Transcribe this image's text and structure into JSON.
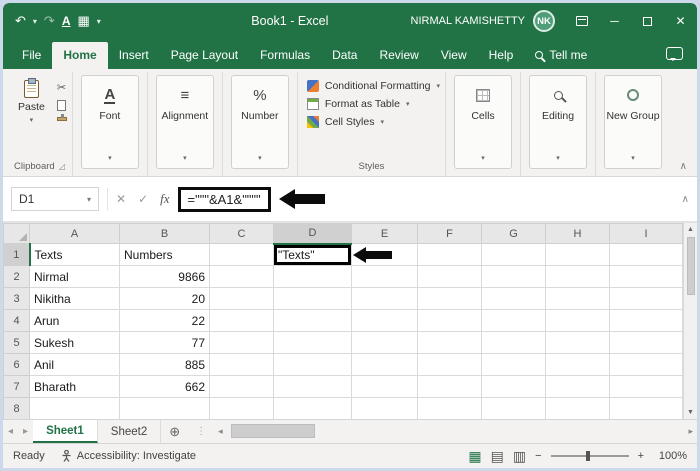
{
  "titlebar": {
    "title": "Book1 - Excel",
    "user": "NIRMAL KAMISHETTY",
    "avatar": "NK",
    "icons": {
      "undo": "↶",
      "redo": "↷",
      "underline": "A",
      "table": "▦",
      "caret": "▾"
    },
    "window": {
      "min": "─",
      "close": "✕"
    }
  },
  "tabs": [
    {
      "label": "File"
    },
    {
      "label": "Home",
      "active": true
    },
    {
      "label": "Insert"
    },
    {
      "label": "Page Layout"
    },
    {
      "label": "Formulas"
    },
    {
      "label": "Data"
    },
    {
      "label": "Review"
    },
    {
      "label": "View"
    },
    {
      "label": "Help"
    },
    {
      "label": "Tell me"
    }
  ],
  "ribbon": {
    "paste": "Paste",
    "caret": "▾",
    "collapse": "∧",
    "cut": "✂",
    "font_icon": "A",
    "alignment_icon": "≡",
    "number_icon": "%",
    "styles_items": [
      "Conditional Formatting",
      "Format as Table",
      "Cell Styles"
    ],
    "groups": {
      "clipboard": "Clipboard",
      "font": "Font",
      "alignment": "Alignment",
      "number": "Number",
      "styles": "Styles",
      "cells": "Cells",
      "editing": "Editing",
      "new_group": "New Group"
    },
    "launcher": "◿"
  },
  "formula_bar": {
    "name_box": "D1",
    "caret": "▾",
    "cancel": "✕",
    "enter": "✓",
    "fx": "fx",
    "formula": "=\"\"\"&A1&\"\"\"\"",
    "expand": "∧"
  },
  "grid": {
    "columns": [
      "A",
      "B",
      "C",
      "D",
      "E",
      "F",
      "G",
      "H",
      "I"
    ],
    "selected": {
      "col": "D",
      "row": "1"
    },
    "rows": [
      {
        "num": "1",
        "cells": [
          "Texts",
          "Numbers",
          "",
          "\"Texts\"",
          "",
          "",
          "",
          "",
          ""
        ]
      },
      {
        "num": "2",
        "cells": [
          "Nirmal",
          "9866",
          "",
          "",
          "",
          "",
          "",
          "",
          ""
        ]
      },
      {
        "num": "3",
        "cells": [
          "Nikitha",
          "20",
          "",
          "",
          "",
          "",
          "",
          "",
          ""
        ]
      },
      {
        "num": "4",
        "cells": [
          "Arun",
          "22",
          "",
          "",
          "",
          "",
          "",
          "",
          ""
        ]
      },
      {
        "num": "5",
        "cells": [
          "Sukesh",
          "77",
          "",
          "",
          "",
          "",
          "",
          "",
          ""
        ]
      },
      {
        "num": "6",
        "cells": [
          "Anil",
          "885",
          "",
          "",
          "",
          "",
          "",
          "",
          ""
        ]
      },
      {
        "num": "7",
        "cells": [
          "Bharath",
          "662",
          "",
          "",
          "",
          "",
          "",
          "",
          ""
        ]
      },
      {
        "num": "8",
        "cells": [
          "",
          "",
          "",
          "",
          "",
          "",
          "",
          "",
          ""
        ]
      }
    ]
  },
  "sheet_bar": {
    "nav_left": "◂",
    "nav_right": "▸",
    "tabs": [
      {
        "label": "Sheet1",
        "active": true
      },
      {
        "label": "Sheet2",
        "active": false
      }
    ],
    "add": "⊕",
    "dots": "⋮",
    "scroll_up": "▲",
    "scroll_down": "▼"
  },
  "status_bar": {
    "ready": "Ready",
    "accessibility": "Accessibility: Investigate",
    "views": [
      "▦",
      "▤",
      "▥"
    ],
    "minus": "−",
    "plus": "+",
    "zoom": "100%"
  }
}
